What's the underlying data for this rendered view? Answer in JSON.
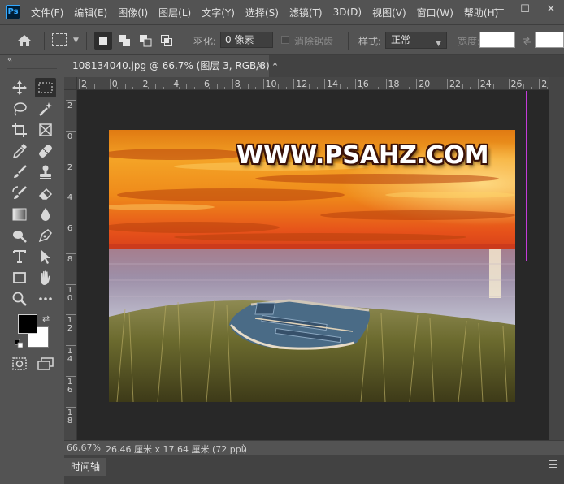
{
  "app": {
    "logo_text": "Ps"
  },
  "menu": [
    "文件(F)",
    "编辑(E)",
    "图像(I)",
    "图层(L)",
    "文字(Y)",
    "选择(S)",
    "滤镜(T)",
    "3D(D)",
    "视图(V)",
    "窗口(W)",
    "帮助(H)"
  ],
  "window_controls": {
    "minimize": "—",
    "maximize": "☐",
    "close": "✕"
  },
  "options": {
    "feather_label": "羽化:",
    "feather_value": "0 像素",
    "antialias_label": "消除锯齿",
    "style_label": "样式:",
    "style_value": "正常",
    "width_label": "宽度:"
  },
  "document": {
    "tab_title": "108134040.jpg @ 66.7% (图层 3, RGB/8) *",
    "close_glyph": "×"
  },
  "ruler": {
    "h_labels": [
      "2",
      "0",
      "2",
      "4",
      "6",
      "8",
      "10",
      "12",
      "14",
      "16",
      "18",
      "20",
      "22",
      "24",
      "26",
      "2"
    ],
    "v_labels": [
      "2",
      "0",
      "2",
      "4",
      "6",
      "8",
      "1\n0",
      "1\n2",
      "1\n4",
      "1\n6",
      "1\n8"
    ]
  },
  "canvas": {
    "watermark": "WWW.PSAHZ.COM",
    "colors": {
      "pasteboard": "#282828",
      "guide": "#c43bd9"
    }
  },
  "status": {
    "zoom": "66.67%",
    "dimensions": "26.46 厘米 x 17.64 厘米 (72 ppi)",
    "arrow": "〉"
  },
  "panels": {
    "timeline_tab": "时间轴"
  },
  "toolbar": {
    "collapse_glyph": "«",
    "icons": [
      "move-icon",
      "rect-marquee-icon",
      "lasso-icon",
      "magic-wand-icon",
      "crop-icon",
      "frame-icon",
      "eyedropper-icon",
      "healing-brush-icon",
      "brush-icon",
      "stamp-icon",
      "history-brush-icon",
      "eraser-icon",
      "gradient-icon",
      "blur-drop-icon",
      "dodge-icon",
      "pen-icon",
      "type-icon",
      "path-select-icon",
      "rectangle-shape-icon",
      "hand-icon",
      "zoom-icon",
      "more-tools-icon",
      "quick-mask-icon",
      "screen-mode-icon"
    ],
    "colors": {
      "foreground": "#000000",
      "background": "#ffffff"
    }
  }
}
